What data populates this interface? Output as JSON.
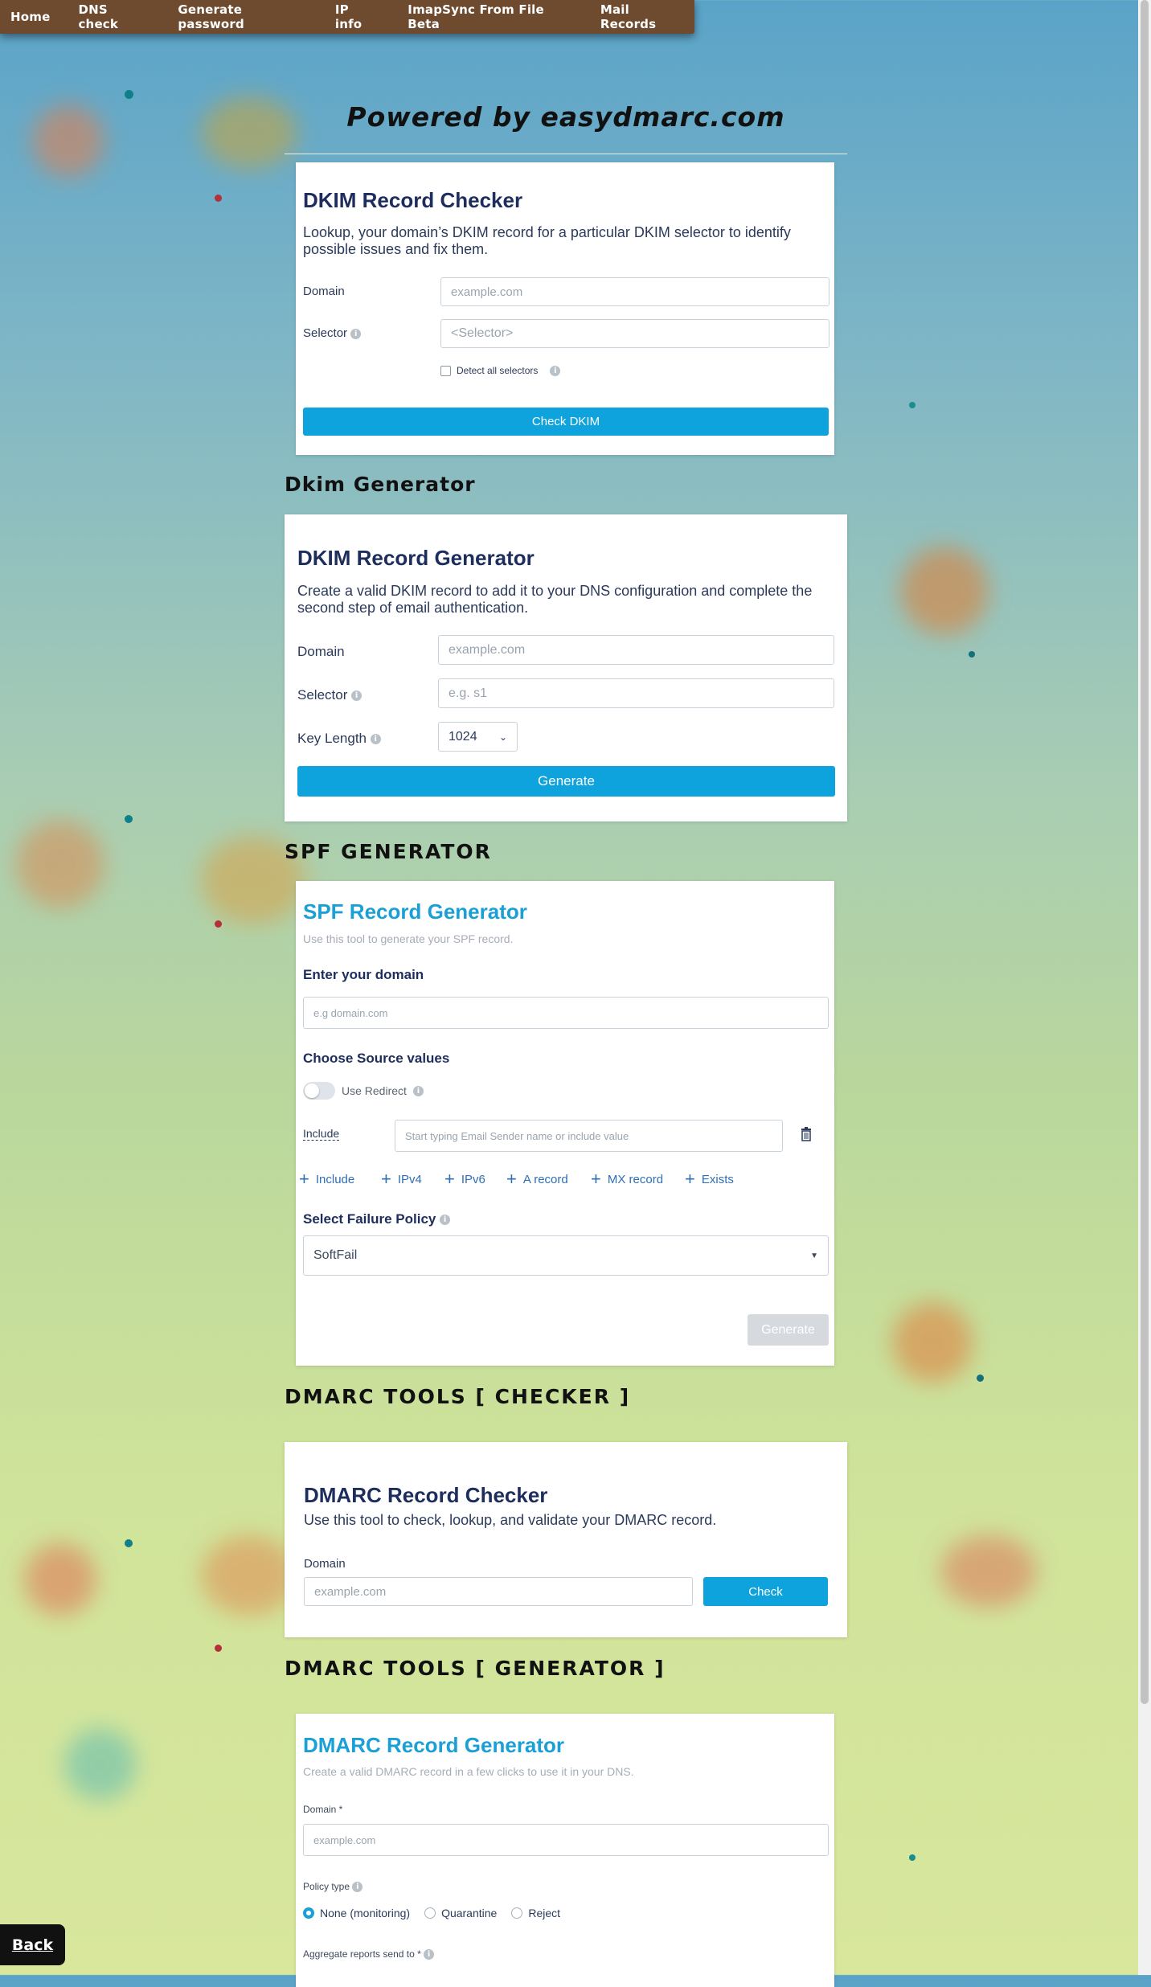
{
  "nav": {
    "items": [
      "Home",
      "DNS check",
      "Generate password",
      "IP info",
      "ImapSync From File Beta",
      "Mail Records"
    ]
  },
  "powered": "Powered by easydmarc.com",
  "dkim_checker": {
    "title": "DKIM Record Checker",
    "description": "Lookup, your domain’s DKIM record for a particular DKIM selector to identify possible issues and fix them.",
    "domain_label": "Domain",
    "domain_placeholder": "example.com",
    "selector_label": "Selector",
    "selector_placeholder": "<Selector>",
    "detect_all_label": "Detect all selectors",
    "button": "Check DKIM"
  },
  "dkim_generator_section": "Dkim Generator",
  "dkim_generator": {
    "title": "DKIM Record Generator",
    "description": "Create a valid DKIM record to add it to your DNS configuration and complete the second step of email authentication.",
    "domain_label": "Domain",
    "domain_placeholder": "example.com",
    "selector_label": "Selector",
    "selector_placeholder": "e.g. s1",
    "key_length_label": "Key Length",
    "key_length_value": "1024",
    "button": "Generate"
  },
  "spf_section": "SPF GENERATOR",
  "spf": {
    "title": "SPF Record Generator",
    "subtitle": "Use this tool to generate your SPF record.",
    "domain_heading": "Enter your domain",
    "domain_placeholder": "e.g domain.com",
    "source_heading": "Choose Source values",
    "redirect_label": "Use Redirect",
    "include_label": "Include",
    "include_placeholder": "Start typing Email Sender name or include value",
    "add_items": [
      "Include",
      "IPv4",
      "IPv6",
      "A record",
      "MX record",
      "Exists"
    ],
    "failure_heading": "Select Failure Policy",
    "failure_value": "SoftFail",
    "button": "Generate"
  },
  "dmarc_checker_section": "DMARC TOOLS [ CHECKER ]",
  "dmarc_checker": {
    "title": "DMARC Record Checker",
    "description": "Use this tool to check, lookup, and validate your DMARC record.",
    "domain_label": "Domain",
    "domain_placeholder": "example.com",
    "button": "Check"
  },
  "dmarc_generator_section": "DMARC TOOLS [ GENERATOR ]",
  "dmarc_generator": {
    "title": "DMARC Record Generator",
    "subtitle": "Create a valid DMARC record in a few clicks to use it in your DNS.",
    "domain_label": "Domain *",
    "domain_placeholder": "example.com",
    "policy_label": "Policy type",
    "policy_options": [
      "None (monitoring)",
      "Quarantine",
      "Reject"
    ],
    "policy_selected": "None (monitoring)",
    "aggregate_label": "Aggregate reports send to *"
  },
  "back": "Back"
}
